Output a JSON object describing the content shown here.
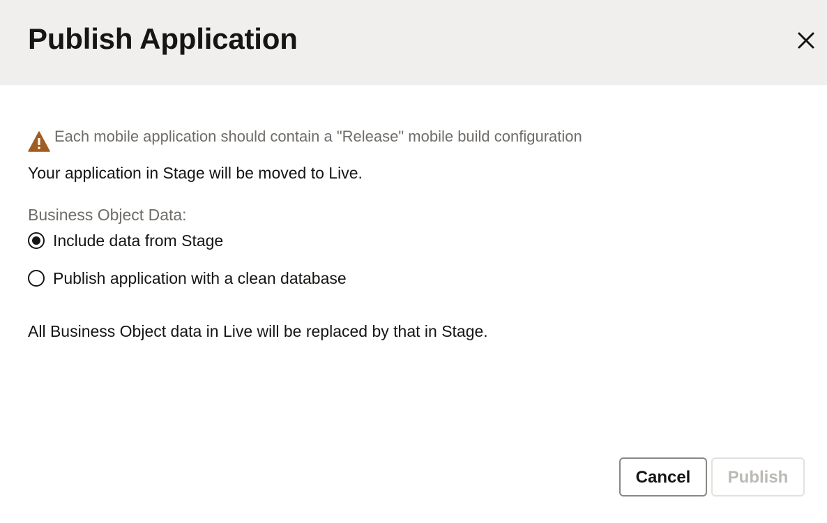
{
  "dialog": {
    "title": "Publish Application",
    "close_icon": "close-icon"
  },
  "warning": {
    "icon": "warning-icon",
    "icon_color": "#a15d20",
    "text": "Each mobile application should contain a \"Release\" mobile build configuration"
  },
  "info": "Your application in Stage will be moved to Live.",
  "business_object_data": {
    "label": "Business Object Data:",
    "options": [
      {
        "label": "Include data from Stage",
        "selected": true
      },
      {
        "label": "Publish application with a clean database",
        "selected": false
      }
    ]
  },
  "note": "All Business Object data in Live will be replaced by that in Stage.",
  "footer": {
    "cancel_label": "Cancel",
    "publish_label": "Publish",
    "publish_disabled": true
  },
  "colors": {
    "header_bg": "#f1efed",
    "text_primary": "#161513",
    "text_secondary": "#6f6c68",
    "disabled_text": "#bcb9b5"
  }
}
